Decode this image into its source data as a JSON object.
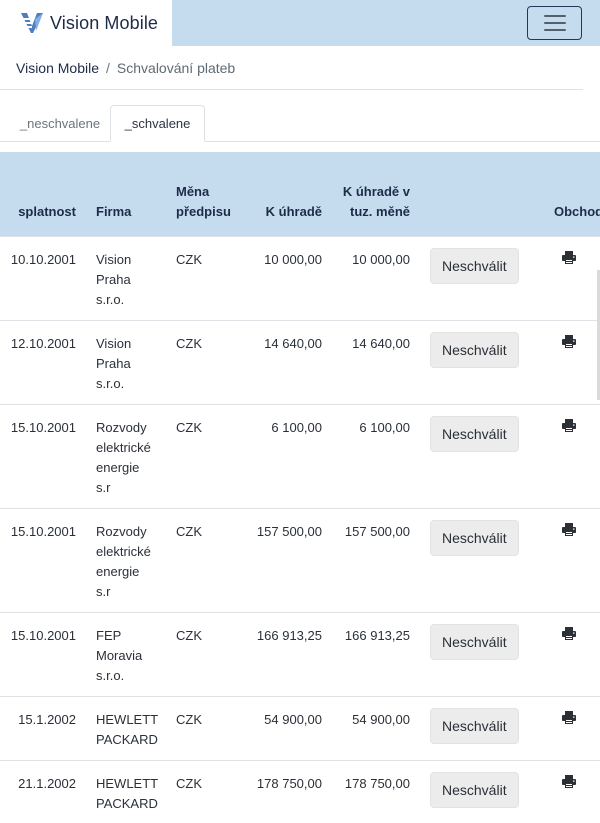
{
  "navbar": {
    "brand": "Vision Mobile",
    "logo_icon": "vision-v-logo",
    "menu_icon": "hamburger-icon"
  },
  "breadcrumb": {
    "home": "Vision Mobile",
    "separator": "/",
    "current": "Schvalování plateb"
  },
  "tabs": [
    {
      "label": "_neschvalene",
      "active": false
    },
    {
      "label": "_schvalene",
      "active": true
    }
  ],
  "table": {
    "headers": {
      "splatnost": "splatnost",
      "firma": "Firma",
      "mena": "Měna předpisu",
      "k_uhrade": "K úhradě",
      "k_uhrade_tuz": "K úhradě v tuz. měně",
      "button_col": "",
      "obchod": "Obchod"
    },
    "rows": [
      {
        "splatnost": "10.10.2001",
        "firma": "Vision Praha s.r.o.",
        "mena": "CZK",
        "k_uhrade": "10 000,00",
        "k_uhrade_tuz": "10 000,00",
        "button": "Neschválit",
        "icon": "print-icon"
      },
      {
        "splatnost": "12.10.2001",
        "firma": "Vision Praha s.r.o.",
        "mena": "CZK",
        "k_uhrade": "14 640,00",
        "k_uhrade_tuz": "14 640,00",
        "button": "Neschválit",
        "icon": "print-icon"
      },
      {
        "splatnost": "15.10.2001",
        "firma": "Rozvody elektrické energie s.r",
        "mena": "CZK",
        "k_uhrade": "6 100,00",
        "k_uhrade_tuz": "6 100,00",
        "button": "Neschválit",
        "icon": "print-icon"
      },
      {
        "splatnost": "15.10.2001",
        "firma": "Rozvody elektrické energie s.r",
        "mena": "CZK",
        "k_uhrade": "157 500,00",
        "k_uhrade_tuz": "157 500,00",
        "button": "Neschválit",
        "icon": "print-icon"
      },
      {
        "splatnost": "15.10.2001",
        "firma": "FEP Moravia s.r.o.",
        "mena": "CZK",
        "k_uhrade": "166 913,25",
        "k_uhrade_tuz": "166 913,25",
        "button": "Neschválit",
        "icon": "print-icon"
      },
      {
        "splatnost": "15.1.2002",
        "firma": "HEWLETT PACKARD",
        "mena": "CZK",
        "k_uhrade": "54 900,00",
        "k_uhrade_tuz": "54 900,00",
        "button": "Neschválit",
        "icon": "print-icon"
      },
      {
        "splatnost": "21.1.2002",
        "firma": "HEWLETT PACKARD",
        "mena": "CZK",
        "k_uhrade": "178 750,00",
        "k_uhrade_tuz": "178 750,00",
        "button": "Neschválit",
        "icon": "print-icon"
      }
    ]
  },
  "colors": {
    "header_bg": "#c5dcef",
    "brand_text": "#1e2b48",
    "button_bg": "#ececec"
  }
}
